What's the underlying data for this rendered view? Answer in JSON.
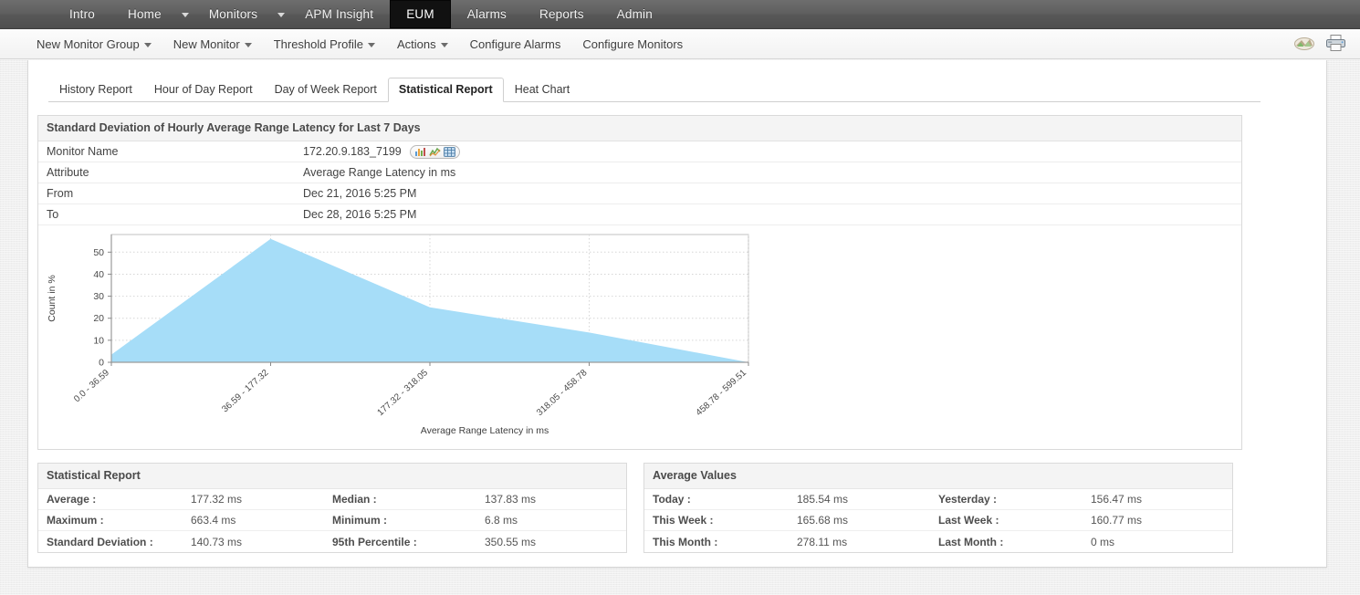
{
  "topnav": {
    "items": [
      {
        "label": "Intro",
        "active": false,
        "caret": false
      },
      {
        "label": "Home",
        "active": false,
        "caret": true
      },
      {
        "label": "Monitors",
        "active": false,
        "caret": true
      },
      {
        "label": "APM Insight",
        "active": false,
        "caret": false
      },
      {
        "label": "EUM",
        "active": true,
        "caret": false
      },
      {
        "label": "Alarms",
        "active": false,
        "caret": false
      },
      {
        "label": "Reports",
        "active": false,
        "caret": false
      },
      {
        "label": "Admin",
        "active": false,
        "caret": false
      }
    ]
  },
  "subbar": {
    "items": [
      {
        "label": "New Monitor Group",
        "caret": true
      },
      {
        "label": "New Monitor",
        "caret": true
      },
      {
        "label": "Threshold Profile",
        "caret": true
      },
      {
        "label": "Actions",
        "caret": true
      },
      {
        "label": "Configure Alarms",
        "caret": false
      },
      {
        "label": "Configure Monitors",
        "caret": false
      }
    ],
    "right_icons": [
      {
        "name": "export-chart-icon"
      },
      {
        "name": "printer-icon"
      }
    ]
  },
  "tabs": [
    {
      "label": "History Report",
      "active": false
    },
    {
      "label": "Hour of Day Report",
      "active": false
    },
    {
      "label": "Day of Week Report",
      "active": false
    },
    {
      "label": "Statistical Report",
      "active": true
    },
    {
      "label": "Heat Chart",
      "active": false
    }
  ],
  "report": {
    "title": "Standard Deviation of Hourly Average Range Latency for Last 7 Days",
    "rows": [
      {
        "label": "Monitor Name",
        "value": "172.20.9.183_7199",
        "icons": true
      },
      {
        "label": "Attribute",
        "value": "Average Range Latency in ms",
        "icons": false
      },
      {
        "label": "From",
        "value": "Dec 21, 2016 5:25 PM",
        "icons": false
      },
      {
        "label": "To",
        "value": "Dec 28, 2016 5:25 PM",
        "icons": false
      }
    ]
  },
  "chart_data": {
    "type": "area",
    "title": "",
    "xlabel": "Average Range Latency in ms",
    "ylabel": "Count in %",
    "categories": [
      "0.0 - 36.59",
      "36.59 - 177.32",
      "177.32 - 318.05",
      "318.05 - 458.78",
      "458.78 - 599.51"
    ],
    "values": [
      3.5,
      56,
      25,
      13.5,
      0
    ],
    "yticks": [
      0,
      10,
      20,
      30,
      40,
      50
    ],
    "ylim": [
      0,
      58
    ],
    "grid": true,
    "legend": "none",
    "series_color": "#a6ddf8"
  },
  "statistical_report": {
    "title": "Statistical Report",
    "rows": [
      {
        "k": "Average :",
        "v": "177.32 ms",
        "k2": "Median :",
        "v2": "137.83 ms"
      },
      {
        "k": "Maximum :",
        "v": "663.4 ms",
        "k2": "Minimum :",
        "v2": "6.8 ms"
      },
      {
        "k": "Standard Deviation :",
        "v": "140.73 ms",
        "k2": "95th Percentile :",
        "v2": "350.55 ms"
      }
    ]
  },
  "average_values": {
    "title": "Average Values",
    "rows": [
      {
        "k": "Today :",
        "v": "185.54 ms",
        "k2": "Yesterday :",
        "v2": "156.47 ms"
      },
      {
        "k": "This Week :",
        "v": "165.68 ms",
        "k2": "Last Week :",
        "v2": "160.77 ms"
      },
      {
        "k": "This Month :",
        "v": "278.11 ms",
        "k2": "Last Month :",
        "v2": "0 ms"
      }
    ]
  }
}
